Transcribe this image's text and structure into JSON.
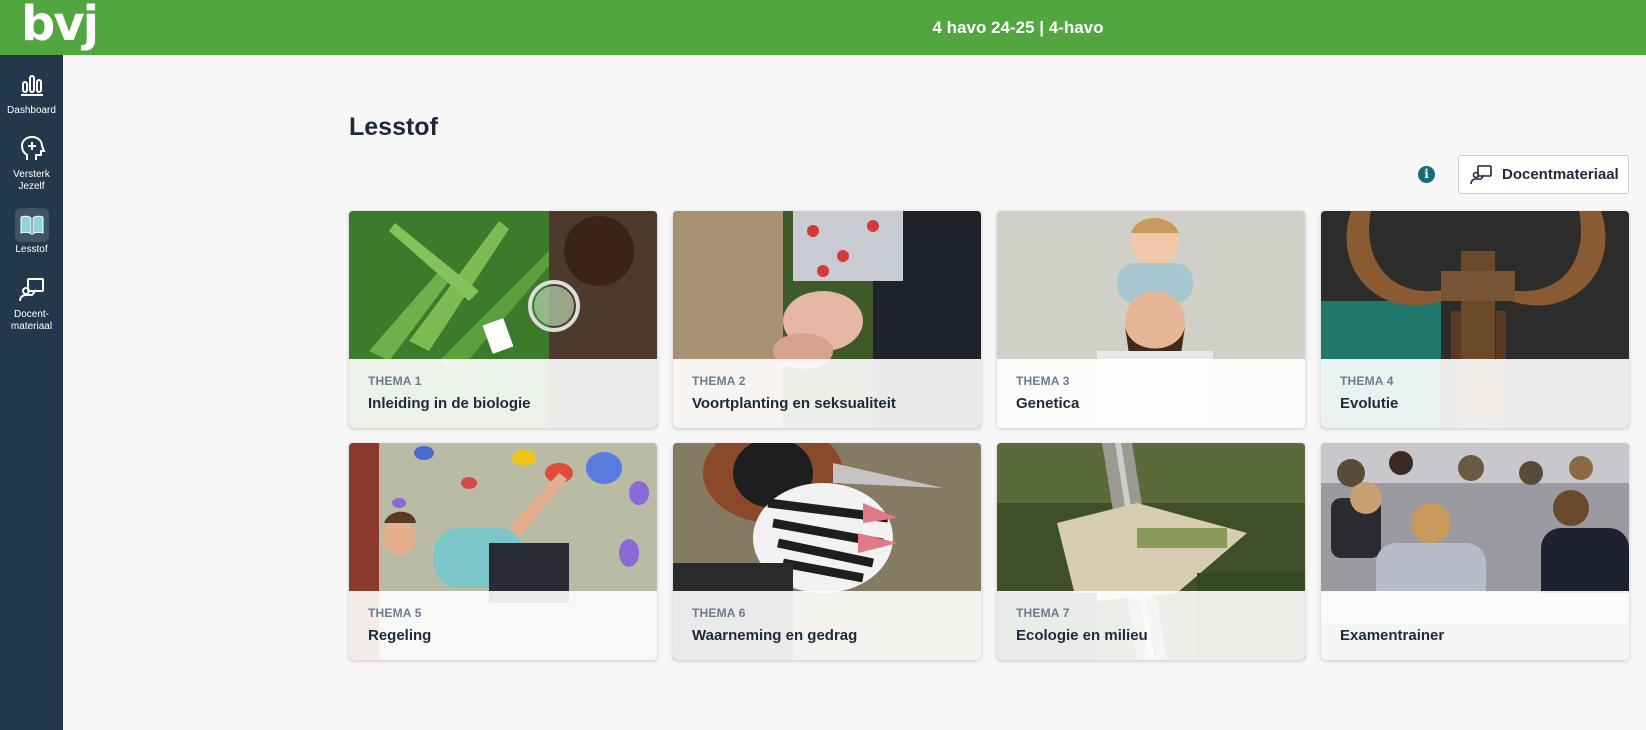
{
  "header": {
    "logo": "bvj",
    "class_title": "4 havo 24-25 | 4-havo",
    "brand_color": "#52a63f"
  },
  "sidebar": {
    "bg_color": "#23384b",
    "items": [
      {
        "label": "Dashboard",
        "icon": "bar-chart-icon",
        "active": false
      },
      {
        "label": "Versterk\nJezelf",
        "icon": "head-plus-icon",
        "active": false
      },
      {
        "label": "Lesstof",
        "icon": "open-book-icon",
        "active": true
      },
      {
        "label": "Docent-\nmateriaal",
        "icon": "teacher-board-icon",
        "active": false
      }
    ]
  },
  "main": {
    "title": "Lesstof",
    "info_icon": "info-icon",
    "docent_button_label": "Docentmateriaal",
    "cards": [
      {
        "kicker": "THEMA 1",
        "title": "Inleiding in de biologie",
        "image": "scientist-with-magnifier-plant"
      },
      {
        "kicker": "THEMA 2",
        "title": "Voortplanting en seksualiteit",
        "image": "holding-hands"
      },
      {
        "kicker": "THEMA 3",
        "title": "Genetica",
        "image": "child-on-fathers-shoulders"
      },
      {
        "kicker": "THEMA 4",
        "title": "Evolutie",
        "image": "mammoth-skeleton"
      },
      {
        "kicker": "THEMA 5",
        "title": "Regeling",
        "image": "girl-climbing-wall"
      },
      {
        "kicker": "THEMA 6",
        "title": "Waarneming en gedrag",
        "image": "grebe-bird-with-chick"
      },
      {
        "kicker": "THEMA 7",
        "title": "Ecologie en milieu",
        "image": "wildlife-overpass-aerial"
      },
      {
        "kicker": "",
        "title": "Examentrainer",
        "image": "students-taking-exam"
      }
    ]
  }
}
